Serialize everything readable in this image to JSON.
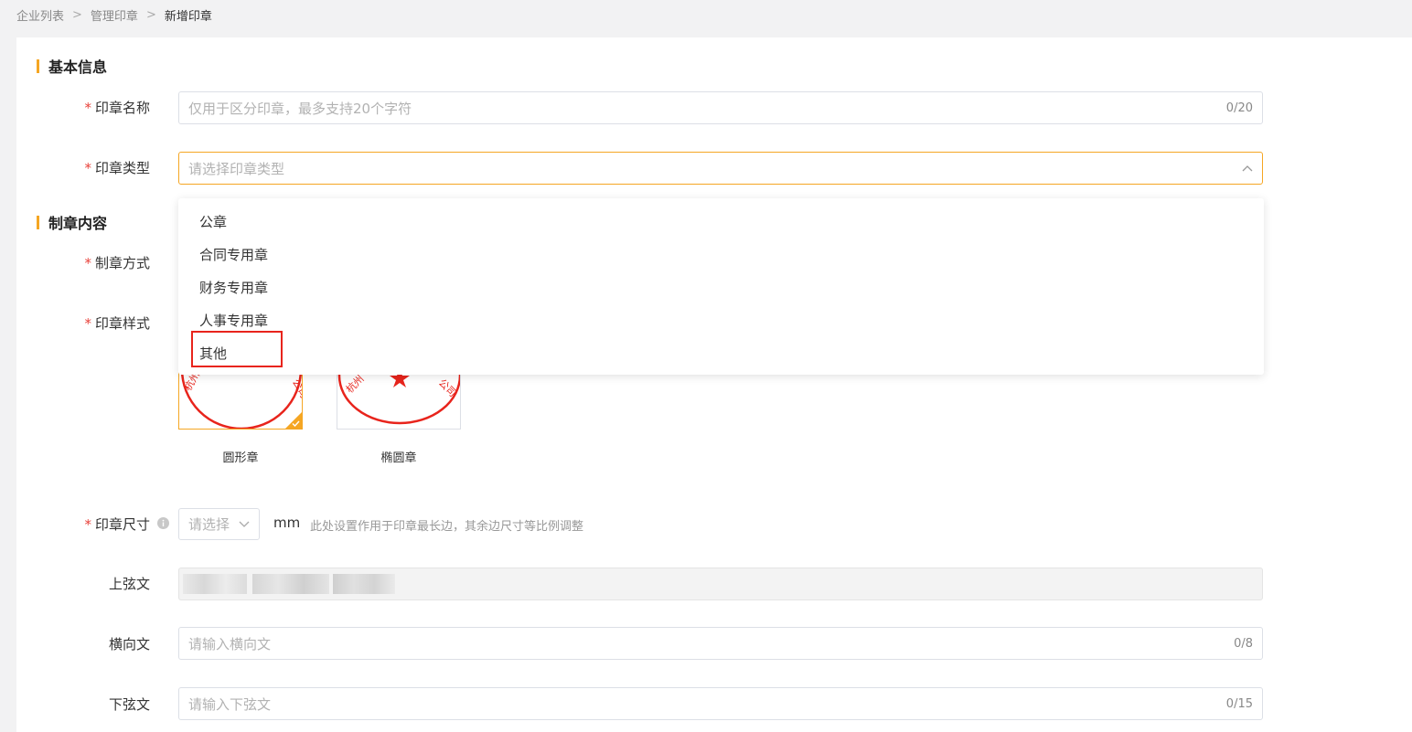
{
  "breadcrumb": {
    "items": [
      "企业列表",
      "管理印章"
    ],
    "current": "新增印章",
    "separator": ">"
  },
  "sections": {
    "basic_info": "基本信息",
    "content": "制章内容"
  },
  "fields": {
    "name": {
      "label": "印章名称",
      "placeholder": "仅用于区分印章，最多支持20个字符",
      "counter": "0/20"
    },
    "type": {
      "label": "印章类型",
      "placeholder": "请选择印章类型"
    },
    "method": {
      "label": "制章方式"
    },
    "style": {
      "label": "印章样式",
      "options": [
        "圆形章",
        "椭圆章"
      ],
      "selected": "圆形章"
    },
    "size": {
      "label": "印章尺寸",
      "placeholder": "请选择",
      "unit": "mm",
      "hint": "此处设置作用于印章最长边，其余边尺寸等比例调整"
    },
    "upper_text": {
      "label": "上弦文"
    },
    "horizontal_text": {
      "label": "横向文",
      "placeholder": "请输入横向文",
      "counter": "0/8"
    },
    "lower_text": {
      "label": "下弦文",
      "placeholder": "请输入下弦文",
      "counter": "0/15"
    }
  },
  "dropdown": {
    "options": [
      "公章",
      "合同专用章",
      "财务专用章",
      "人事专用章",
      "其他"
    ],
    "highlighted": "其他"
  },
  "seal_text": {
    "left": "杭州",
    "right": "公司"
  },
  "colors": {
    "accent": "#f5a623",
    "required": "#e8413a",
    "seal_red": "#e8241c"
  },
  "icons": {
    "select_open": "chevron-up-icon",
    "select_closed": "chevron-down-icon",
    "info": "info-icon",
    "check": "check-icon"
  }
}
